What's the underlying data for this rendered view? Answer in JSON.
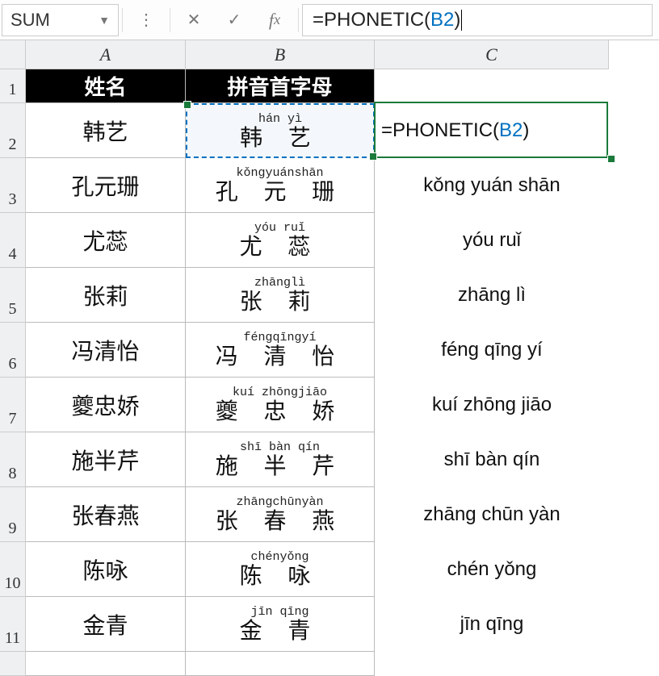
{
  "nameBox": "SUM",
  "formula": {
    "prefix": "=PHONETIC(",
    "ref": "B2",
    "suffix": ")"
  },
  "columns": [
    "A",
    "B",
    "C"
  ],
  "headerRow": {
    "A": "姓名",
    "B": "拼音首字母"
  },
  "rows": [
    {
      "n": "2",
      "name": "韩艺",
      "py": "hán yì",
      "chars": "韩 艺",
      "c": {
        "prefix": "=PHONETIC(",
        "ref": "B2",
        "suffix": ")"
      }
    },
    {
      "n": "3",
      "name": "孔元珊",
      "py": "kǒngyuánshān",
      "chars": "孔 元 珊",
      "c": "kǒng yuán shān"
    },
    {
      "n": "4",
      "name": "尤蕊",
      "py": "yóu ruǐ",
      "chars": "尤 蕊",
      "c": "yóu ruǐ"
    },
    {
      "n": "5",
      "name": "张莉",
      "py": "zhānglì",
      "chars": "张 莉",
      "c": "zhāng lì"
    },
    {
      "n": "6",
      "name": "冯清怡",
      "py": "féngqīngyí",
      "chars": "冯 清 怡",
      "c": "féng qīng yí"
    },
    {
      "n": "7",
      "name": "夔忠娇",
      "py": "kuí zhōngjiāo",
      "chars": "夔 忠 娇",
      "c": "kuí zhōng jiāo"
    },
    {
      "n": "8",
      "name": "施半芹",
      "py": "shī bàn qín",
      "chars": "施 半 芹",
      "c": "shī bàn qín"
    },
    {
      "n": "9",
      "name": "张春燕",
      "py": "zhāngchūnyàn",
      "chars": "张 春 燕",
      "c": "zhāng chūn yàn"
    },
    {
      "n": "10",
      "name": "陈咏",
      "py": "chényǒng",
      "chars": "陈 咏",
      "c": "chén yǒng"
    },
    {
      "n": "11",
      "name": "金青",
      "py": "jīn qīng",
      "chars": "金 青",
      "c": "jīn qīng"
    }
  ],
  "lastRow": {
    "n": "",
    "partial": ""
  }
}
